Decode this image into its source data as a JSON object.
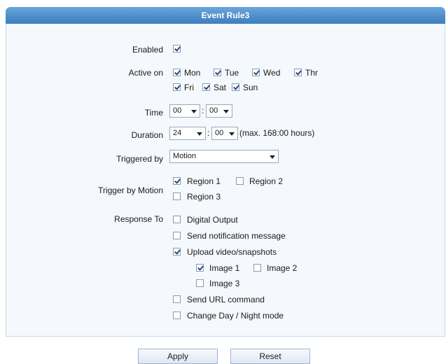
{
  "header": {
    "title": "Event Rule3"
  },
  "labels": {
    "enabled": "Enabled",
    "active_on": "Active on",
    "time": "Time",
    "duration": "Duration",
    "triggered_by": "Triggered by",
    "trigger_by_motion": "Trigger by Motion",
    "response_to": "Response To"
  },
  "enabled": {
    "checked": true
  },
  "days": [
    {
      "label": "Mon",
      "checked": true
    },
    {
      "label": "Tue",
      "checked": true
    },
    {
      "label": "Wed",
      "checked": true
    },
    {
      "label": "Thr",
      "checked": true
    },
    {
      "label": "Fri",
      "checked": true
    },
    {
      "label": "Sat",
      "checked": true
    },
    {
      "label": "Sun",
      "checked": true
    }
  ],
  "time": {
    "hour": "00",
    "minute": "00"
  },
  "duration": {
    "hour": "24",
    "minute": "00",
    "hint": "(max. 168:00 hours)"
  },
  "triggered_by": {
    "value": "Motion"
  },
  "regions": [
    {
      "label": "Region 1",
      "checked": true
    },
    {
      "label": "Region 2",
      "checked": false
    },
    {
      "label": "Region 3",
      "checked": false
    }
  ],
  "responses": {
    "digital_output": {
      "label": "Digital Output",
      "checked": false
    },
    "notification": {
      "label": "Send notification message",
      "checked": false
    },
    "upload": {
      "label": "Upload video/snapshots",
      "checked": true
    },
    "images": [
      {
        "label": "Image 1",
        "checked": true
      },
      {
        "label": "Image 2",
        "checked": false
      },
      {
        "label": "Image 3",
        "checked": false
      }
    ],
    "url_command": {
      "label": "Send URL command",
      "checked": false
    },
    "day_night": {
      "label": "Change Day / Night mode",
      "checked": false
    }
  },
  "buttons": {
    "apply": "Apply",
    "reset": "Reset"
  }
}
